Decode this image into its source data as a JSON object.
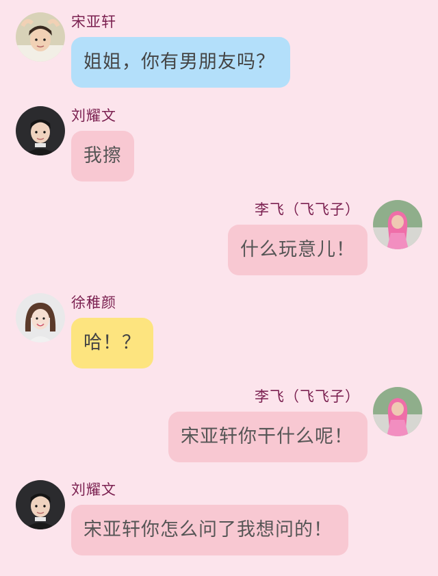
{
  "messages": [
    {
      "sender": "宋亚轩",
      "text": "姐姐，你有男朋友吗？",
      "side": "left",
      "bubble_color": "#b3dffa",
      "avatar": "song-yaxuan-avatar"
    },
    {
      "sender": "刘耀文",
      "text": "我擦",
      "side": "left",
      "bubble_color": "#f8c8d2",
      "avatar": "liu-yaowen-avatar"
    },
    {
      "sender": "李飞（飞飞子）",
      "text": "什么玩意儿！",
      "side": "right",
      "bubble_color": "#f8c8d2",
      "avatar": "li-fei-avatar"
    },
    {
      "sender": "徐稚颜",
      "text": "哈！？",
      "side": "left",
      "bubble_color": "#fde47f",
      "avatar": "xu-zhiyan-avatar"
    },
    {
      "sender": "李飞（飞飞子）",
      "text": "宋亚轩你干什么呢！",
      "side": "right",
      "bubble_color": "#f8c8d2",
      "avatar": "li-fei-avatar"
    },
    {
      "sender": "刘耀文",
      "text": "宋亚轩你怎么问了我想问的！",
      "side": "left",
      "bubble_color": "#f8c8d2",
      "avatar": "liu-yaowen-avatar"
    }
  ],
  "colors": {
    "background": "#fce4ec",
    "name_text": "#7a1f4f"
  }
}
